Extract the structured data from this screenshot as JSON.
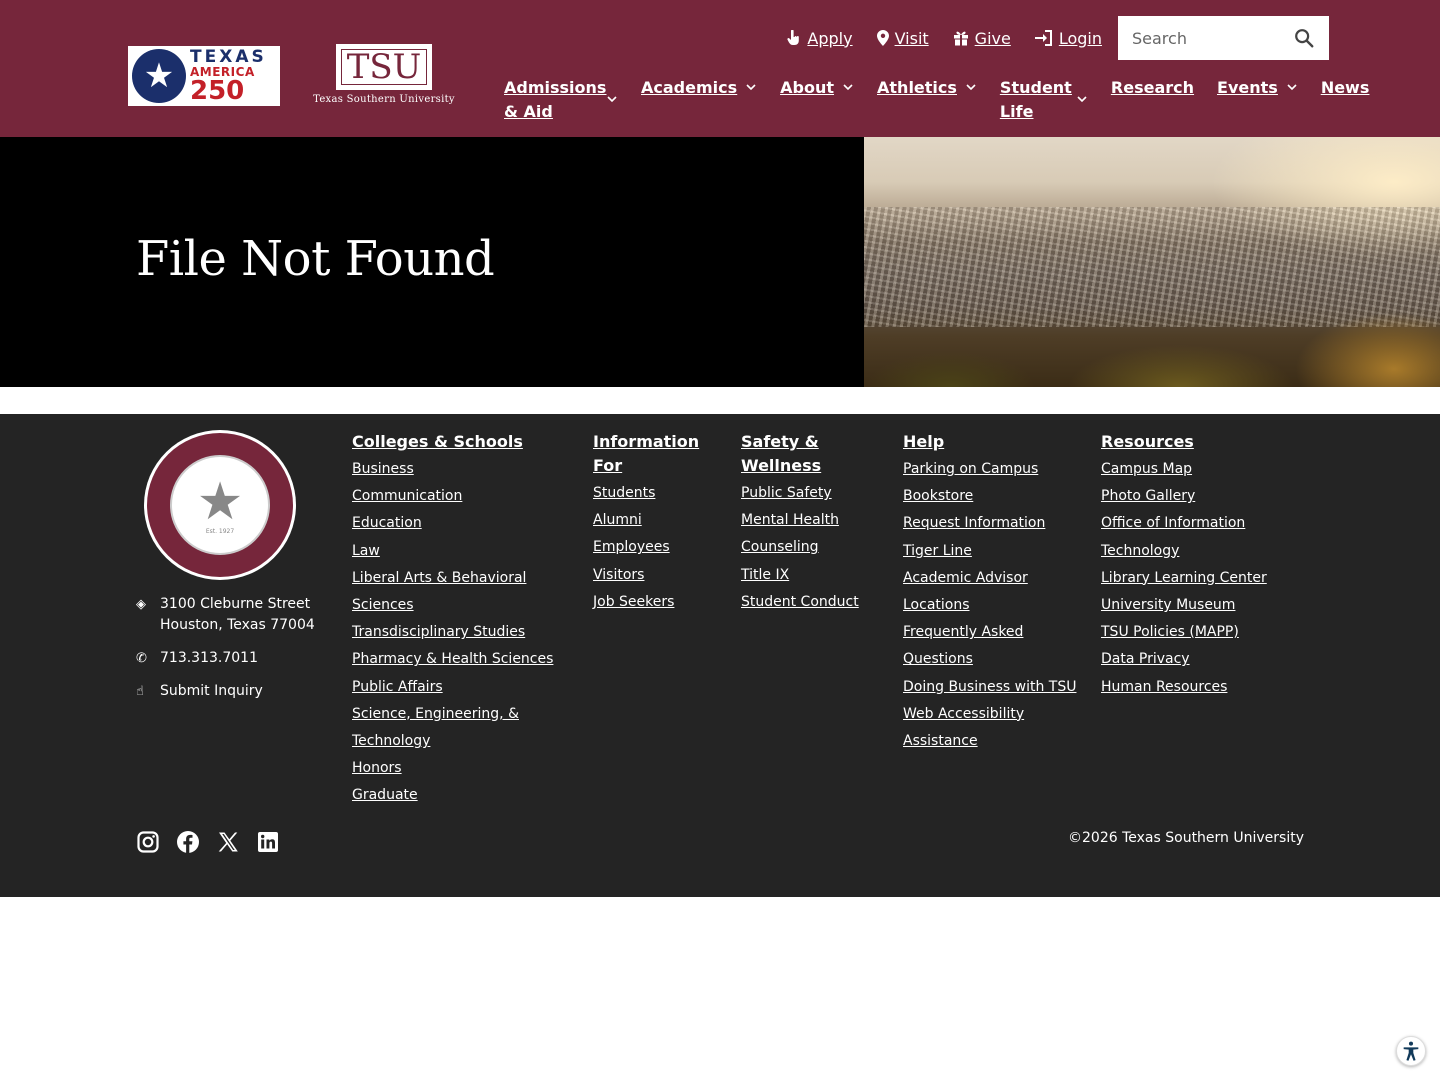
{
  "colors": {
    "brand_maroon": "#76263b",
    "footer_bg": "#242424",
    "hero_bg": "#000000"
  },
  "header": {
    "logo_250": {
      "line1": "TEXAS",
      "line2": "AMERICA",
      "line3": "250"
    },
    "logo_tsu": {
      "mark": "TSU",
      "name": "Texas Southern University"
    },
    "utility": [
      {
        "label": "Apply",
        "icon": "pointer-hand-icon"
      },
      {
        "label": "Visit",
        "icon": "map-pin-icon"
      },
      {
        "label": "Give",
        "icon": "gift-icon"
      },
      {
        "label": "Login",
        "icon": "sign-in-icon"
      }
    ],
    "search": {
      "placeholder": "Search",
      "icon": "search-icon"
    },
    "nav": [
      {
        "label": "Admissions & Aid",
        "dropdown": true
      },
      {
        "label": "Academics",
        "dropdown": true
      },
      {
        "label": "About",
        "dropdown": true
      },
      {
        "label": "Athletics",
        "dropdown": true
      },
      {
        "label": "Student Life",
        "dropdown": true
      },
      {
        "label": "Research",
        "dropdown": false
      },
      {
        "label": "Events",
        "dropdown": true
      },
      {
        "label": "News",
        "dropdown": false
      }
    ]
  },
  "hero": {
    "title": "File Not Found"
  },
  "footer": {
    "seal": {
      "text": "TEXAS SOUTHERN UNIVERSITY",
      "est": "Est. 1927"
    },
    "contact": {
      "address_line1": "3100 Cleburne Street",
      "address_line2": "Houston, Texas 77004",
      "phone": "713.313.7011",
      "inquiry": "Submit Inquiry"
    },
    "columns": [
      {
        "heading": "Colleges & Schools",
        "links": [
          "Business",
          "Communication",
          "Education",
          "Law",
          "Liberal Arts & Behavioral Sciences",
          "Transdisciplinary Studies",
          "Pharmacy & Health Sciences",
          "Public Affairs",
          "Science, Engineering, &",
          "Technology",
          "Honors",
          "Graduate"
        ]
      },
      {
        "heading": "Information For",
        "links": [
          "Students",
          "Alumni",
          "Employees",
          "Visitors",
          "Job Seekers"
        ]
      },
      {
        "heading": "Safety & Wellness",
        "links": [
          "Public Safety",
          "Mental Health",
          "Counseling",
          "Title IX",
          "Student Conduct"
        ]
      },
      {
        "heading": "Help",
        "links": [
          "Parking on Campus",
          "Bookstore",
          "Request Information",
          "Tiger Line",
          "Academic Advisor",
          "Locations",
          "Frequently Asked",
          "Questions",
          "Doing Business with TSU",
          "Web Accessibility",
          "Assistance"
        ]
      },
      {
        "heading": "Resources",
        "links": [
          "Campus Map",
          "Photo Gallery",
          "Office of Information",
          "Technology",
          "Library Learning Center",
          "University Museum",
          "TSU Policies (MAPP)",
          "Data Privacy",
          "Human Resources"
        ]
      }
    ],
    "social": [
      "instagram-icon",
      "facebook-icon",
      "x-twitter-icon",
      "linkedin-icon"
    ],
    "copyright": "©2026 Texas Southern University"
  },
  "accessibility_widget": {
    "icon": "accessibility-icon"
  }
}
